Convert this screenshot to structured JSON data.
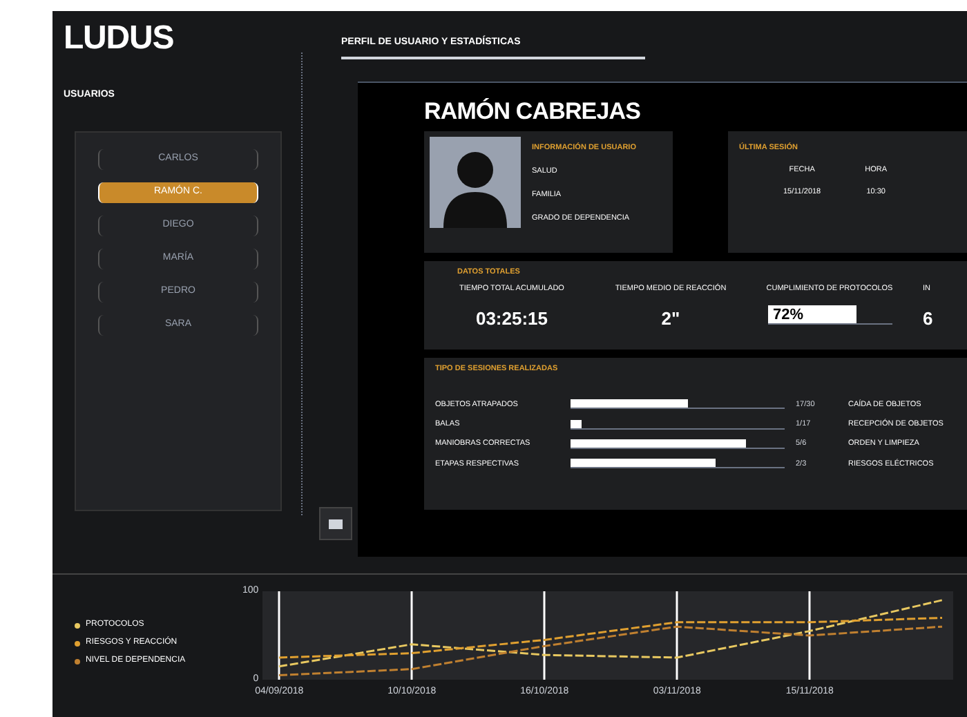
{
  "app": {
    "logo": "LUDUS",
    "section_title": "PERFIL DE USUARIO Y ESTADÍSTICAS"
  },
  "sidebar": {
    "title": "USUARIOS",
    "users": [
      {
        "name": "CARLOS",
        "selected": false
      },
      {
        "name": "RAMÓN C.",
        "selected": true
      },
      {
        "name": "DIEGO",
        "selected": false
      },
      {
        "name": "MARÍA",
        "selected": false
      },
      {
        "name": "PEDRO",
        "selected": false
      },
      {
        "name": "SARA",
        "selected": false
      }
    ]
  },
  "profile": {
    "name": "RAMÓN CABREJAS",
    "user_info": {
      "title": "INFORMACIÓN DE USUARIO",
      "lines": [
        "SALUD",
        "FAMILIA",
        "GRADO DE DEPENDENCIA"
      ]
    },
    "last_session": {
      "title": "ÚLTIMA SESIÓN",
      "columns": [
        {
          "label": "FECHA",
          "value": "15/11/2018"
        },
        {
          "label": "HORA",
          "value": "10:30"
        }
      ]
    },
    "totals": {
      "title": "DATOS TOTALES",
      "items": [
        {
          "kind": "text",
          "label": "TIEMPO TOTAL ACUMULADO",
          "value": "03:25:15"
        },
        {
          "kind": "text",
          "label": "TIEMPO MEDIO DE REACCIÓN",
          "value": "2\""
        },
        {
          "kind": "meter",
          "label": "CUMPLIMIENTO DE PROTOCOLOS",
          "value": "72%",
          "level": 0.72
        },
        {
          "kind": "text",
          "label": "IN",
          "value": "6"
        }
      ]
    },
    "sessions": {
      "title": "TIPO DE SESIONES REALIZADAS",
      "rows": [
        {
          "label": "OBJETOS ATRAPADOS",
          "level": 0.55,
          "reading": "17/30",
          "category": "CAÍDA DE OBJETOS"
        },
        {
          "label": "BALAS",
          "level": 0.05,
          "reading": "1/17",
          "category": "RECEPCIÓN DE OBJETOS"
        },
        {
          "label": "MANIOBRAS CORRECTAS",
          "level": 0.82,
          "reading": "5/6",
          "category": "ORDEN Y LIMPIEZA"
        },
        {
          "label": "ETAPAS RESPECTIVAS",
          "level": 0.68,
          "reading": "2/3",
          "category": "RIESGOS ELÉCTRICOS"
        }
      ]
    }
  },
  "history": {
    "chart_data": {
      "type": "line",
      "categories": [
        "04/09/2018",
        "10/10/2018",
        "16/10/2018",
        "03/11/2018",
        "15/11/2018",
        null
      ],
      "yticks": [
        0,
        100
      ],
      "ylim": [
        0,
        100
      ],
      "grid": true,
      "series": [
        {
          "name": "PROTOCOLOS",
          "color": "#e8c860",
          "line_style": "dashed",
          "values": [
            15,
            40,
            28,
            25,
            55,
            90
          ]
        },
        {
          "name": "RIESGOS Y REACCIÓN",
          "color": "#e0a030",
          "line_style": "dashed",
          "values": [
            25,
            30,
            45,
            65,
            65,
            70
          ]
        },
        {
          "name": "NIVEL DE DEPENDENCIA",
          "color": "#c08030",
          "line_style": "dashed",
          "values": [
            5,
            12,
            38,
            60,
            50,
            60
          ]
        }
      ]
    }
  }
}
